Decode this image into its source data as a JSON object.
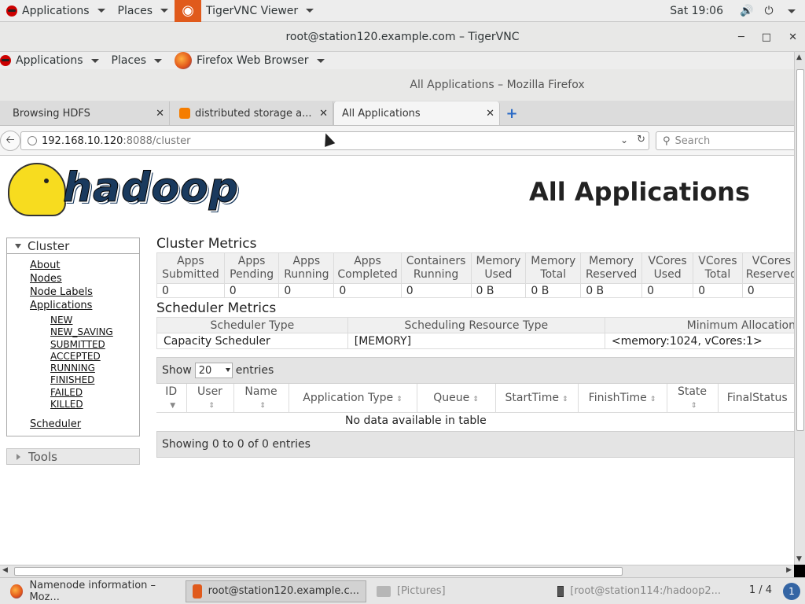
{
  "topbar": {
    "applications": "Applications",
    "places": "Places",
    "window_app": "TigerVNC Viewer",
    "clock": "Sat 19:06"
  },
  "vnc": {
    "title": "root@station120.example.com – TigerVNC"
  },
  "inner_topbar": {
    "applications": "Applications",
    "places": "Places",
    "window_app": "Firefox Web Browser"
  },
  "firefox": {
    "title": "All Applications – Mozilla Firefox",
    "tabs": [
      {
        "label": "Browsing HDFS"
      },
      {
        "label": "distributed storage a..."
      },
      {
        "label": "All Applications"
      }
    ],
    "url_host": "192.168.10.120",
    "url_path": ":8088/cluster",
    "search_placeholder": "Search"
  },
  "page": {
    "logo_text": "hadoop",
    "title": "All Applications",
    "sidebar": {
      "cluster": "Cluster",
      "links": [
        "About",
        "Nodes",
        "Node Labels",
        "Applications"
      ],
      "app_states": [
        "NEW",
        "NEW_SAVING",
        "SUBMITTED",
        "ACCEPTED",
        "RUNNING",
        "FINISHED",
        "FAILED",
        "KILLED"
      ],
      "scheduler": "Scheduler",
      "tools": "Tools"
    },
    "cluster_metrics": {
      "title": "Cluster Metrics",
      "headers": [
        [
          "Apps",
          "Submitted"
        ],
        [
          "Apps",
          "Pending"
        ],
        [
          "Apps",
          "Running"
        ],
        [
          "Apps",
          "Completed"
        ],
        [
          "Containers",
          "Running"
        ],
        [
          "Memory",
          "Used"
        ],
        [
          "Memory",
          "Total"
        ],
        [
          "Memory",
          "Reserved"
        ],
        [
          "VCores",
          "Used"
        ],
        [
          "VCores",
          "Total"
        ],
        [
          "VCores",
          "Reserved"
        ]
      ],
      "values": [
        "0",
        "0",
        "0",
        "0",
        "0",
        "0 B",
        "0 B",
        "0 B",
        "0",
        "0",
        "0"
      ]
    },
    "scheduler_metrics": {
      "title": "Scheduler Metrics",
      "headers": [
        "Scheduler Type",
        "Scheduling Resource Type",
        "Minimum Allocation"
      ],
      "values": [
        "Capacity Scheduler",
        "[MEMORY]",
        "<memory:1024, vCores:1>"
      ]
    },
    "apps_table": {
      "show_label": "Show",
      "page_size": "20",
      "entries_label": "entries",
      "columns": [
        "ID",
        "User",
        "Name",
        "Application Type",
        "Queue",
        "StartTime",
        "FinishTime",
        "State",
        "FinalStatus"
      ],
      "empty_text": "No data available in table",
      "info": "Showing 0 to 0 of 0 entries"
    }
  },
  "taskbar": {
    "tasks": [
      "Namenode information – Moz...",
      "root@station120.example.c...",
      "[Pictures]",
      "[root@station114:/hadoop2..."
    ],
    "pager": "1 / 4",
    "notify_count": "1"
  }
}
